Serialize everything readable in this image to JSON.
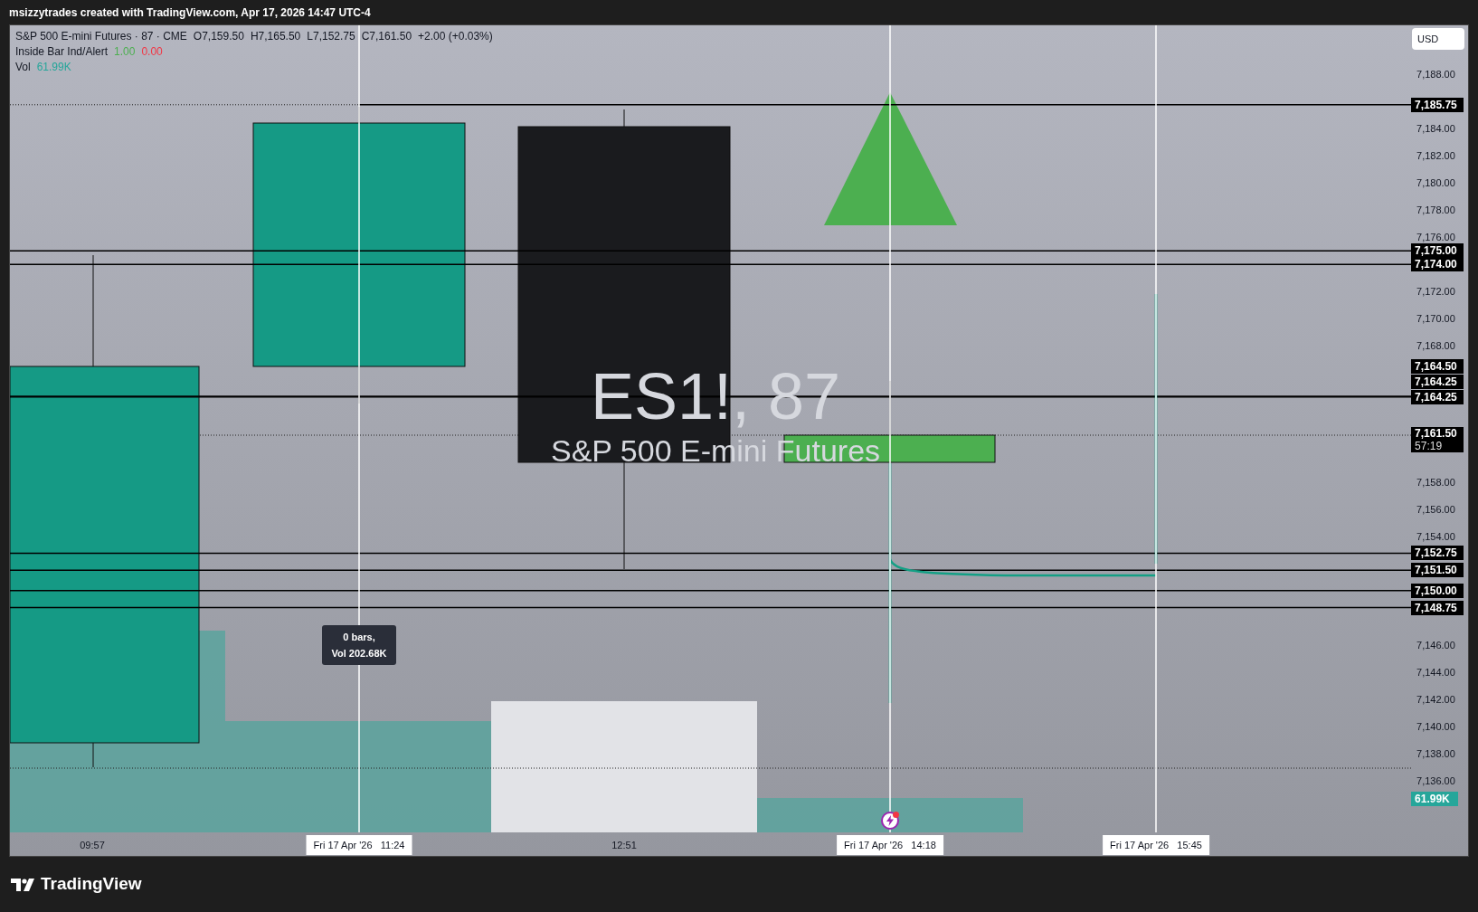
{
  "header": {
    "title": "msizzytrades created with TradingView.com, Apr 17, 2026 14:47 UTC-4"
  },
  "legend": {
    "symbol": "S&P 500 E-mini Futures · 87 · CME",
    "ohlc": [
      "O7,159.50",
      "H7,165.50",
      "L7,152.75",
      "C7,161.50"
    ],
    "change": "+2.00 (+0.03%)",
    "indicators": [
      {
        "name": "Inside Bar Ind/Alert",
        "values": [
          {
            "text": "1.00",
            "color": "#4caf50"
          },
          {
            "text": "0.00",
            "color": "#f23645"
          }
        ]
      },
      {
        "name": "Vol",
        "values": [
          {
            "text": "61.99K",
            "color": "#26a69a"
          }
        ]
      }
    ]
  },
  "watermark": {
    "symbol": "ES1!, 87",
    "description": "S&P 500 E-mini Futures"
  },
  "tooltip": {
    "lines": [
      "0 bars,",
      "Vol 202.68K"
    ]
  },
  "currency_button": "USD",
  "price_ticks": [
    "7,188.00",
    "7,184.00",
    "7,182.00",
    "7,180.00",
    "7,178.00",
    "7,176.00",
    "7,172.00",
    "7,170.00",
    "7,168.00",
    "7,158.00",
    "7,156.00",
    "7,154.00",
    "7,146.00",
    "7,144.00",
    "7,142.00",
    "7,140.00",
    "7,138.00",
    "7,136.00"
  ],
  "price_labels": [
    {
      "kind": "line",
      "text": "7,185.75"
    },
    {
      "kind": "line",
      "text": "7,175.00"
    },
    {
      "kind": "line",
      "text": "7,174.00"
    },
    {
      "kind": "line",
      "text": "7,164.50"
    },
    {
      "kind": "line",
      "text": "7,164.25"
    },
    {
      "kind": "line",
      "text": "7,164.25"
    },
    {
      "kind": "last",
      "text": "7,161.50",
      "countdown": "57:19"
    },
    {
      "kind": "line",
      "text": "7,152.75"
    },
    {
      "kind": "line",
      "text": "7,151.50"
    },
    {
      "kind": "line",
      "text": "7,150.00"
    },
    {
      "kind": "line",
      "text": "7,148.75"
    },
    {
      "kind": "volume",
      "text": "61.99K"
    }
  ],
  "time_labels": [
    {
      "text": "09:57",
      "highlighted": false
    },
    {
      "text": "Fri 17 Apr '26   11:24",
      "highlighted": true
    },
    {
      "text": "12:51",
      "highlighted": false
    },
    {
      "text": "Fri 17 Apr '26   14:18",
      "highlighted": true
    },
    {
      "text": "Fri 17 Apr '26   15:45",
      "highlighted": true
    }
  ],
  "footer": {
    "brand": "TradingView"
  }
}
